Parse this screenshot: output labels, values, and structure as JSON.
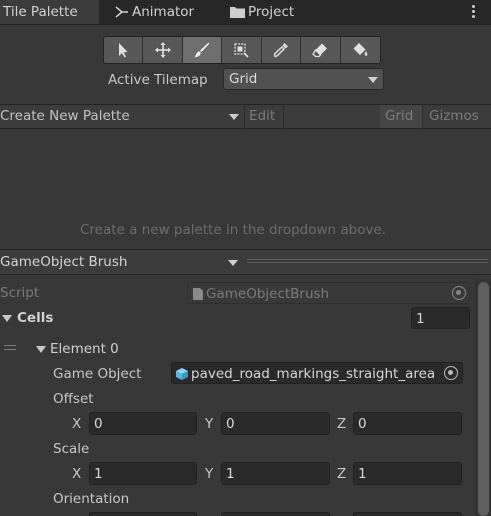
{
  "tabs": [
    {
      "label": "Tile Palette",
      "icon": "none",
      "active": true
    },
    {
      "label": "Animator",
      "icon": "animator-icon"
    },
    {
      "label": "Project",
      "icon": "folder-icon"
    }
  ],
  "more_icon": "kebab-menu-icon",
  "tools": [
    "select-icon",
    "move-icon",
    "paint-brush-icon",
    "box-fill-icon",
    "picker-icon",
    "eraser-icon",
    "fill-bucket-icon"
  ],
  "active_tool": "paint-brush-icon",
  "active_tilemap": {
    "label": "Active Tilemap",
    "value": "Grid"
  },
  "palette_toolbar": {
    "create_label": "Create New Palette",
    "edit_label": "Edit",
    "grid_label": "Grid",
    "gizmos_label": "Gizmos"
  },
  "palette_hint": "Create a new palette in the dropdown above.",
  "brush": {
    "label": "GameObject Brush"
  },
  "inspector": {
    "script_label": "Script",
    "script_value": "GameObjectBrush",
    "cells_label": "Cells",
    "cells_count": "1",
    "element_label": "Element 0",
    "game_object_label": "Game Object",
    "game_object_value": "paved_road_markings_straight_area",
    "offset_label": "Offset",
    "offset": {
      "x": "0",
      "y": "0",
      "z": "0"
    },
    "scale_label": "Scale",
    "scale": {
      "x": "1",
      "y": "1",
      "z": "1"
    },
    "orientation_label": "Orientation",
    "axis_x": "X",
    "axis_y": "Y",
    "axis_z": "Z"
  },
  "colors": {
    "background": "#383838",
    "field": "#2a2a2a",
    "tab_active": "#3c3c3c",
    "prefab_icon": "#5bb6e8"
  }
}
